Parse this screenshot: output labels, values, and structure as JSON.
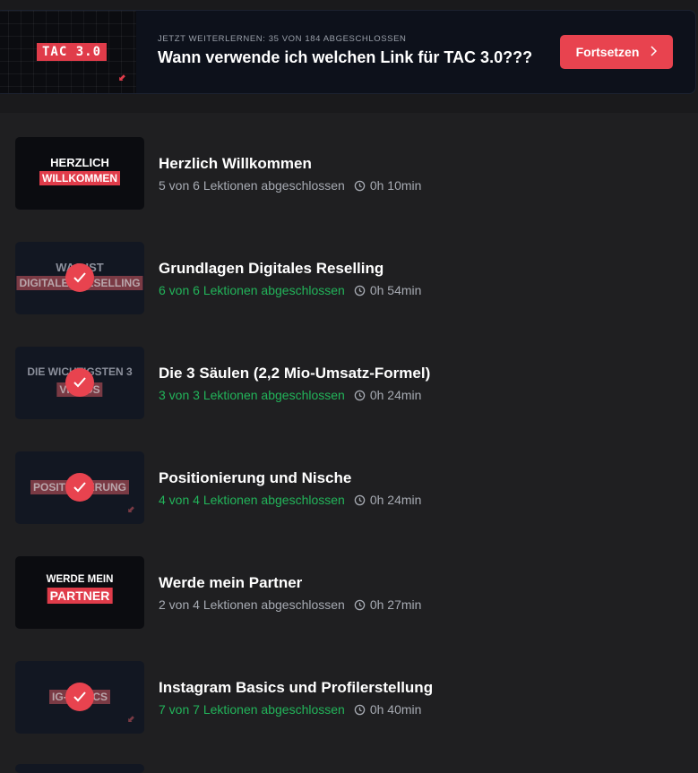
{
  "resume": {
    "thumb_label": "TAC 3.0",
    "subtitle": "JETZT WEITERLERNEN: 35 VON 184 ABGESCHLOSSEN",
    "title": "Wann verwende ich welchen Link für TAC 3.0???",
    "button_label": "Fortsetzen",
    "accent": "#e8434f"
  },
  "courses": [
    {
      "title": "Herzlich Willkommen",
      "progress": "5 von 6 Lektionen abgeschlossen",
      "duration": "0h 10min",
      "completed": false,
      "thumb": {
        "line1": "HERZLICH",
        "highlight": "WILLKOMMEN"
      }
    },
    {
      "title": "Grundlagen Digitales Reselling",
      "progress": "6 von 6 Lektionen abgeschlossen",
      "duration": "0h 54min",
      "completed": true,
      "thumb": {
        "line1": "WAS IST",
        "highlight": "DIGITALES RESELLING"
      }
    },
    {
      "title": "Die 3 Säulen (2,2 Mio-Umsatz-Formel)",
      "progress": "3 von 3 Lektionen abgeschlossen",
      "duration": "0h 24min",
      "completed": true,
      "thumb": {
        "line1": "DIE WICHTIGSTEN 3",
        "highlight": "VIDEOS"
      }
    },
    {
      "title": "Positionierung und Nische",
      "progress": "4 von 4 Lektionen abgeschlossen",
      "duration": "0h 24min",
      "completed": true,
      "thumb": {
        "line1": "",
        "highlight": "POSITIONIERUNG"
      }
    },
    {
      "title": "Werde mein Partner",
      "progress": "2 von 4 Lektionen abgeschlossen",
      "duration": "0h 27min",
      "completed": false,
      "thumb": {
        "line1": "WERDE MEIN",
        "highlight": "PARTNER"
      }
    },
    {
      "title": "Instagram Basics und Profilerstellung",
      "progress": "7 von 7 Lektionen abgeschlossen",
      "duration": "0h 40min",
      "completed": true,
      "thumb": {
        "line1": "",
        "highlight": "IG-BASICS"
      }
    }
  ],
  "colors": {
    "complete": "#22b45a",
    "incomplete": "#a7abb3",
    "background": "#1f1f21"
  },
  "icons": {
    "check": "checkmark-icon",
    "clock": "clock-icon",
    "chevron": "chevron-right-icon"
  }
}
